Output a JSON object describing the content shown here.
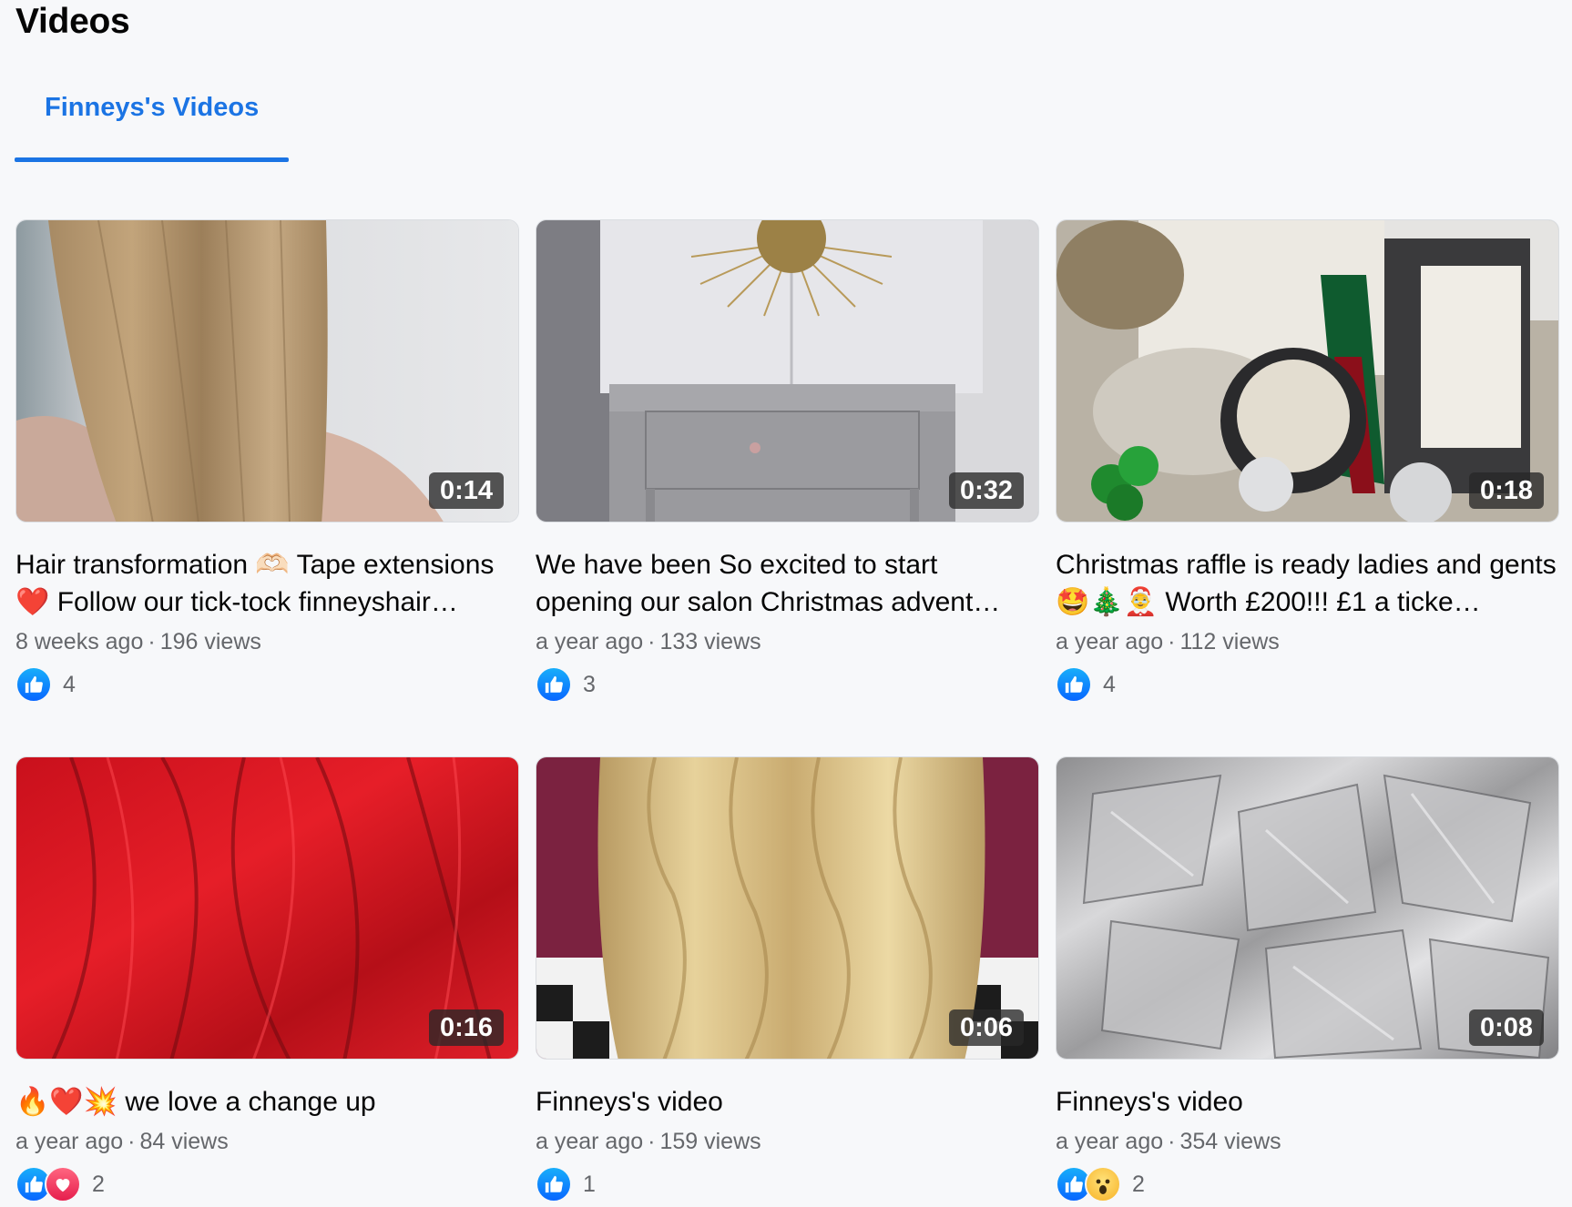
{
  "section": {
    "title": "Videos"
  },
  "tabs": [
    {
      "label": "Finneys's Videos",
      "active": true
    }
  ],
  "colors": {
    "accent": "#1b74e4",
    "secondary_text": "#65676b",
    "like_blue": "#0866ff",
    "love_red": "#e61e4d"
  },
  "videos": [
    {
      "duration": "0:14",
      "title": "Hair transformation 🫶🏻 Tape extensions ❤️ Follow our tick-tock finneyshair…",
      "age": "8 weeks ago",
      "separator": "·",
      "views": "196 views",
      "reactions": [
        "like-icon"
      ],
      "reaction_count": "4"
    },
    {
      "duration": "0:32",
      "title": "We have been So excited to start opening our salon Christmas advent…",
      "age": "a year ago",
      "separator": "·",
      "views": "133 views",
      "reactions": [
        "like-icon"
      ],
      "reaction_count": "3"
    },
    {
      "duration": "0:18",
      "title": "Christmas raffle is ready ladies and gents 🤩🎄🤶 Worth £200!!! £1 a ticke…",
      "age": "a year ago",
      "separator": "·",
      "views": "112 views",
      "reactions": [
        "like-icon"
      ],
      "reaction_count": "4"
    },
    {
      "duration": "0:16",
      "title": "🔥❤️💥 we love a change up",
      "age": "a year ago",
      "separator": "·",
      "views": "84 views",
      "reactions": [
        "like-icon",
        "love-icon"
      ],
      "reaction_count": "2"
    },
    {
      "duration": "0:06",
      "title": "Finneys's video",
      "age": "a year ago",
      "separator": "·",
      "views": "159 views",
      "reactions": [
        "like-icon"
      ],
      "reaction_count": "1"
    },
    {
      "duration": "0:08",
      "title": "Finneys's video",
      "age": "a year ago",
      "separator": "·",
      "views": "354 views",
      "reactions": [
        "like-icon",
        "wow-icon"
      ],
      "reaction_count": "2"
    }
  ]
}
